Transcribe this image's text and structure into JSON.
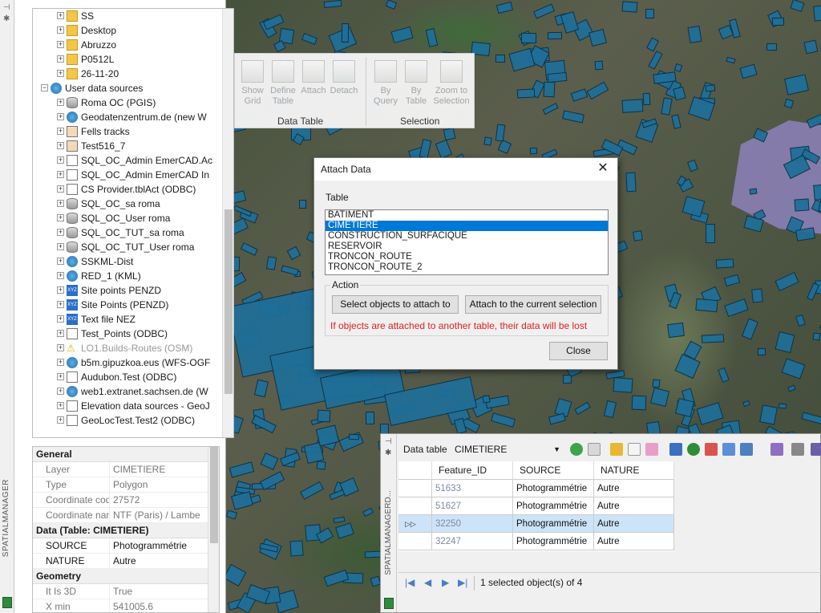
{
  "left_dock": {
    "title": "SPATIALMANAGER"
  },
  "tree": {
    "items": [
      {
        "label": "SS",
        "icon": "folder-icon",
        "level": 2
      },
      {
        "label": "Desktop",
        "icon": "folder-icon",
        "level": 2
      },
      {
        "label": "Abruzzo",
        "icon": "folder-icon",
        "level": 2
      },
      {
        "label": "P0512L",
        "icon": "folder-icon",
        "level": 2
      },
      {
        "label": "26-11-20",
        "icon": "folder-icon",
        "level": 2
      },
      {
        "label": "User data sources",
        "icon": "users-icon",
        "level": 1
      },
      {
        "label": "Roma OC (PGIS)",
        "icon": "database-icon",
        "level": 2
      },
      {
        "label": "Geodatenzentrum.de (new W",
        "icon": "wfs-icon",
        "level": 2
      },
      {
        "label": "Fells tracks",
        "icon": "no-entry-icon",
        "level": 2
      },
      {
        "label": "Test516_7",
        "icon": "no-entry-icon",
        "level": 2
      },
      {
        "label": "SQL_OC_Admin EmerCAD.Ac",
        "icon": "document-icon",
        "level": 2
      },
      {
        "label": "SQL_OC_Admin EmerCAD In",
        "icon": "document-icon",
        "level": 2
      },
      {
        "label": "CS Provider.tblAct (ODBC)",
        "icon": "document-icon",
        "level": 2
      },
      {
        "label": "SQL_OC_sa roma",
        "icon": "database-icon",
        "level": 2
      },
      {
        "label": "SQL_OC_User roma",
        "icon": "database-icon",
        "level": 2
      },
      {
        "label": "SQL_OC_TUT_sa roma",
        "icon": "database-icon",
        "level": 2
      },
      {
        "label": "SQL_OC_TUT_User roma",
        "icon": "database-icon",
        "level": 2
      },
      {
        "label": "SSKML-Dist",
        "icon": "kml-icon",
        "level": 2
      },
      {
        "label": "RED_1 (KML)",
        "icon": "kml-icon",
        "level": 2
      },
      {
        "label": "Site points PENZD",
        "icon": "xyz-icon",
        "level": 2
      },
      {
        "label": "Site Points (PENZD)",
        "icon": "xyz-icon",
        "level": 2
      },
      {
        "label": "Text file NEZ",
        "icon": "xyz-icon",
        "level": 2
      },
      {
        "label": "Test_Points (ODBC)",
        "icon": "document-icon",
        "level": 2
      },
      {
        "label": "LO1.Builds-Routes (OSM)",
        "icon": "warning-icon",
        "level": 2
      },
      {
        "label": "b5m.gipuzkoa.eus (WFS-OGF",
        "icon": "globe-icon",
        "level": 2
      },
      {
        "label": "Audubon.Test (ODBC)",
        "icon": "document-icon",
        "level": 2
      },
      {
        "label": "web1.extranet.sachsen.de (W",
        "icon": "wfs-icon",
        "level": 2
      },
      {
        "label": "Elevation data sources - GeoJ",
        "icon": "document-icon",
        "level": 2
      },
      {
        "label": "GeoLocTest.Test2 (ODBC)",
        "icon": "document-icon",
        "level": 2
      }
    ]
  },
  "props": {
    "sections": [
      {
        "title": "General",
        "rows": [
          {
            "k": "Layer",
            "v": "CIMETIERE",
            "dark": false
          },
          {
            "k": "Type",
            "v": "Polygon",
            "dark": false
          },
          {
            "k": "Coordinate code",
            "v": "27572",
            "dark": false
          },
          {
            "k": "Coordinate name",
            "v": "NTF (Paris) / Lambe",
            "dark": false
          }
        ]
      },
      {
        "title": "Data (Table: CIMETIERE)",
        "rows": [
          {
            "k": "SOURCE",
            "v": "Photogrammétrie",
            "dark": true
          },
          {
            "k": "NATURE",
            "v": "Autre",
            "dark": true
          }
        ]
      },
      {
        "title": "Geometry",
        "rows": [
          {
            "k": "It Is 3D",
            "v": "True",
            "dark": false
          },
          {
            "k": "X min",
            "v": "541005.6",
            "dark": false
          }
        ]
      }
    ]
  },
  "ribbon": {
    "buttons": [
      {
        "label1": "Show",
        "label2": "Grid"
      },
      {
        "label1": "Define",
        "label2": "Table"
      },
      {
        "label1": "Attach",
        "label2": ""
      },
      {
        "label1": "Detach",
        "label2": ""
      },
      {
        "label1": "By",
        "label2": "Query"
      },
      {
        "label1": "By",
        "label2": "Table"
      },
      {
        "label1": "Zoom to",
        "label2": "Selection"
      }
    ],
    "groups": [
      "Data Table",
      "Selection"
    ]
  },
  "dialog": {
    "title": "Attach Data",
    "table_label": "Table",
    "tables": [
      "BATIMENT",
      "CIMETIERE",
      "CONSTRUCTION_SURFACIQUE",
      "RESERVOIR",
      "TRONCON_ROUTE",
      "TRONCON_ROUTE_2"
    ],
    "selected_table": "CIMETIERE",
    "action_label": "Action",
    "btn_select": "Select objects to attach to",
    "btn_attach": "Attach to the current selection",
    "warning": "If objects are attached to another table, their data will be lost",
    "btn_close": "Close"
  },
  "datatable": {
    "side_title": "SPATIALMANAGERD...",
    "label": "Data table",
    "selected": "CIMETIERE",
    "columns": [
      "Feature_ID",
      "SOURCE",
      "NATURE"
    ],
    "rows": [
      {
        "id": "51633",
        "source": "Photogrammétrie",
        "nature": "Autre",
        "selected": false
      },
      {
        "id": "51627",
        "source": "Photogrammétrie",
        "nature": "Autre",
        "selected": false
      },
      {
        "id": "32250",
        "source": "Photogrammétrie",
        "nature": "Autre",
        "selected": true
      },
      {
        "id": "32247",
        "source": "Photogrammétrie",
        "nature": "Autre",
        "selected": false
      }
    ],
    "status": "1 selected object(s) of 4",
    "current_marker": "▷▷"
  },
  "colors": {
    "accent": "#0078d7",
    "warning_text": "#e02020",
    "building_fill": "#1f6f99",
    "selected_row": "#cce4f7"
  }
}
